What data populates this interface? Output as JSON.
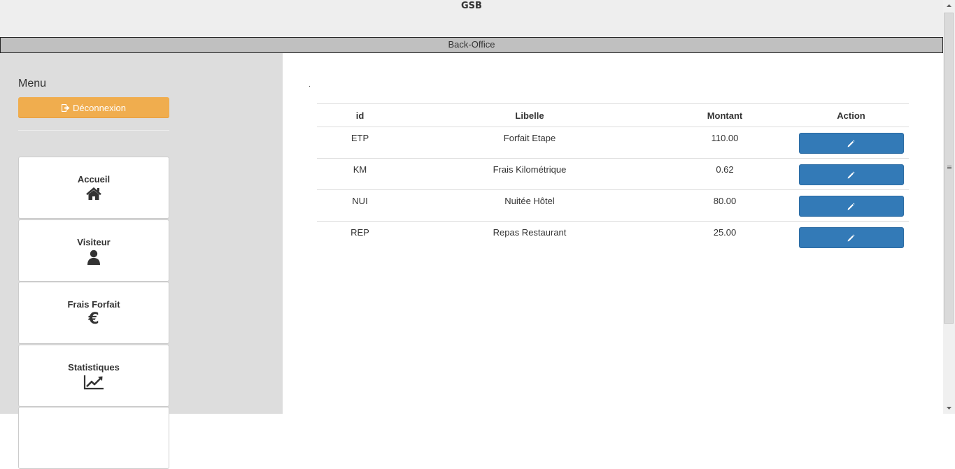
{
  "header": {
    "title": "GSB",
    "subtitle": "Back-Office"
  },
  "sidebar": {
    "menu_title": "Menu",
    "logout": {
      "label": "Déconnexion",
      "icon": "sign-out-icon",
      "color": "#f0ad4e"
    },
    "items": [
      {
        "label": "Accueil",
        "icon": "home-icon"
      },
      {
        "label": "Visiteur",
        "icon": "user-icon"
      },
      {
        "label": "Frais Forfait",
        "icon": "euro-icon",
        "glyph": "€"
      },
      {
        "label": "Statistiques",
        "icon": "line-chart-icon"
      }
    ]
  },
  "main": {
    "dot": ".",
    "table": {
      "columns": [
        "id",
        "Libelle",
        "Montant",
        "Action"
      ],
      "rows": [
        {
          "id": "ETP",
          "libelle": "Forfait Etape",
          "montant": "110.00"
        },
        {
          "id": "KM",
          "libelle": "Frais Kilométrique",
          "montant": "0.62"
        },
        {
          "id": "NUI",
          "libelle": "Nuitée Hôtel",
          "montant": "80.00"
        },
        {
          "id": "REP",
          "libelle": "Repas Restaurant",
          "montant": "25.00"
        }
      ],
      "action_icon": "pencil-icon",
      "action_color": "#337ab7"
    }
  }
}
